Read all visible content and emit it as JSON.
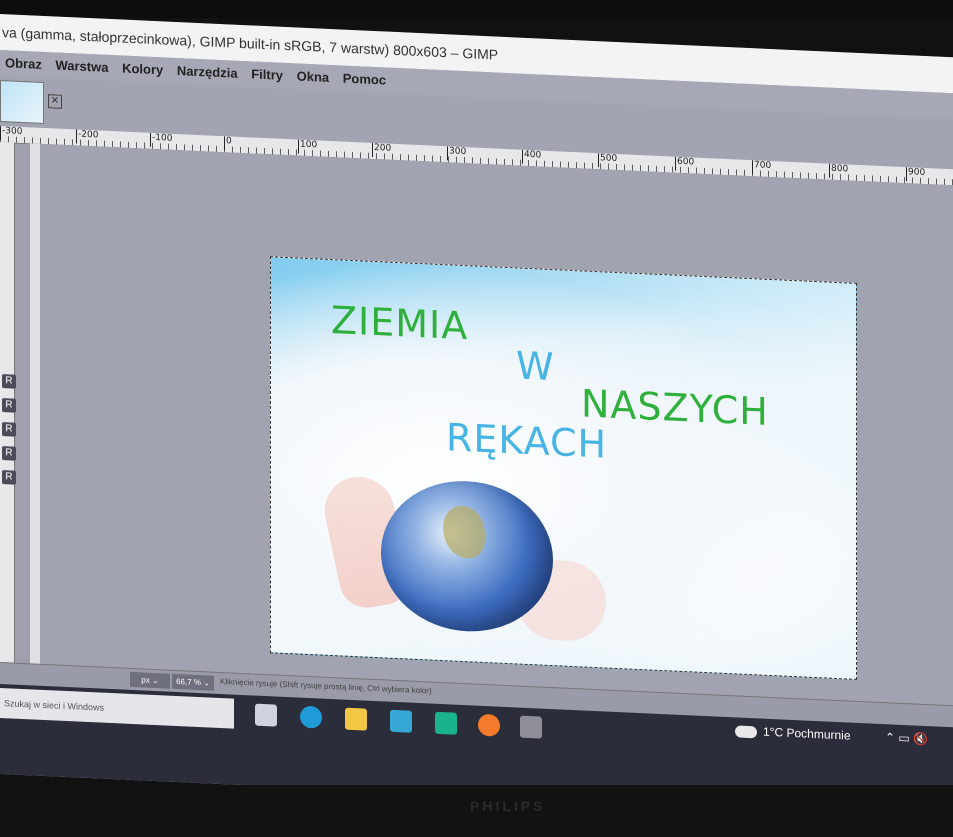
{
  "window": {
    "title": "va (gamma, stałoprzecinkowa), GIMP built-in sRGB, 7 warstw) 800x603 – GIMP"
  },
  "menu": [
    "Obraz",
    "Warstwa",
    "Kolory",
    "Narzędzia",
    "Filtry",
    "Okna",
    "Pomoc"
  ],
  "ruler": {
    "labels": [
      "-300",
      "-200",
      "-100",
      "0",
      "100",
      "200",
      "300",
      "400",
      "500",
      "600",
      "700",
      "800",
      "900"
    ]
  },
  "toolbox": {
    "tools": [
      "R",
      "R",
      "R",
      "R",
      "R"
    ]
  },
  "image": {
    "line1": "ZIEMIA",
    "line2": "W",
    "line3": "NASZYCH",
    "line4": "RĘKACH",
    "colors": {
      "green": "#2fb03c",
      "blue": "#46b4e4"
    }
  },
  "statusbar": {
    "unit": "px",
    "zoom": "66,7 %",
    "message": "Kliknięcie rysuje (Shift rysuje prostą linię, Ctrl wybiera kolor)"
  },
  "taskbar": {
    "search_placeholder": "Szukaj w sieci i Windows",
    "weather": "1°C Pochmurnie"
  },
  "monitor": {
    "brand": "PHILIPS"
  }
}
